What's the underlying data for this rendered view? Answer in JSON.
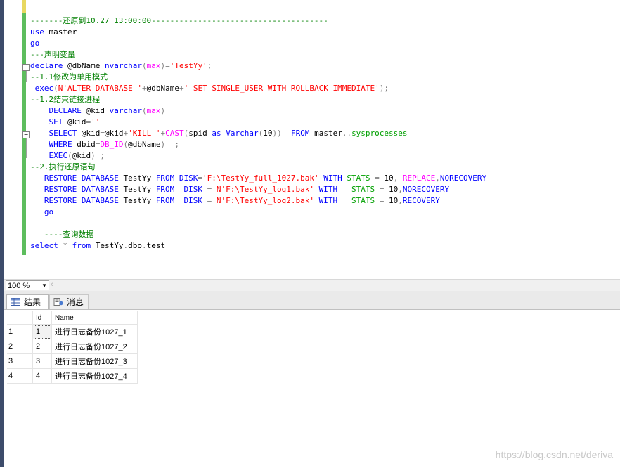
{
  "editor": {
    "lines": [
      [
        {
          "t": "-------还原到10.27 13:00:00--------------------------------------",
          "c": "c"
        }
      ],
      [
        {
          "t": "use",
          "c": "k"
        },
        {
          "t": " master",
          "c": "t"
        }
      ],
      [
        {
          "t": "go",
          "c": "k"
        }
      ],
      [
        {
          "t": "---声明变量",
          "c": "c"
        }
      ],
      [
        {
          "t": "declare",
          "c": "k"
        },
        {
          "t": " @dbName ",
          "c": "t"
        },
        {
          "t": "nvarchar",
          "c": "k"
        },
        {
          "t": "(",
          "c": "g"
        },
        {
          "t": "max",
          "c": "f"
        },
        {
          "t": ")=",
          "c": "g"
        },
        {
          "t": "'TestYy'",
          "c": "s"
        },
        {
          "t": ";",
          "c": "g"
        }
      ],
      [
        {
          "t": "--1.1修改为单用模式",
          "c": "c"
        }
      ],
      [
        {
          "t": " exec",
          "c": "k"
        },
        {
          "t": "(",
          "c": "g"
        },
        {
          "t": "N'ALTER DATABASE '",
          "c": "s"
        },
        {
          "t": "+",
          "c": "g"
        },
        {
          "t": "@dbName",
          "c": "t"
        },
        {
          "t": "+",
          "c": "g"
        },
        {
          "t": "' SET SINGLE_USER WITH ROLLBACK IMMEDIATE'",
          "c": "s"
        },
        {
          "t": ");",
          "c": "g"
        }
      ],
      [
        {
          "t": "--1.2结束链接进程",
          "c": "c"
        }
      ],
      [
        {
          "t": "    DECLARE",
          "c": "k"
        },
        {
          "t": " @kid ",
          "c": "t"
        },
        {
          "t": "varchar",
          "c": "k"
        },
        {
          "t": "(",
          "c": "g"
        },
        {
          "t": "max",
          "c": "f"
        },
        {
          "t": ")",
          "c": "g"
        }
      ],
      [
        {
          "t": "    SET",
          "c": "k"
        },
        {
          "t": " @kid",
          "c": "t"
        },
        {
          "t": "=",
          "c": "g"
        },
        {
          "t": "''",
          "c": "s"
        }
      ],
      [
        {
          "t": "    SELECT",
          "c": "k"
        },
        {
          "t": " @kid",
          "c": "t"
        },
        {
          "t": "=",
          "c": "g"
        },
        {
          "t": "@kid",
          "c": "t"
        },
        {
          "t": "+",
          "c": "g"
        },
        {
          "t": "'KILL '",
          "c": "s"
        },
        {
          "t": "+",
          "c": "g"
        },
        {
          "t": "CAST",
          "c": "f"
        },
        {
          "t": "(",
          "c": "g"
        },
        {
          "t": "spid ",
          "c": "t"
        },
        {
          "t": "as",
          "c": "k"
        },
        {
          "t": " Varchar",
          "c": "k"
        },
        {
          "t": "(",
          "c": "g"
        },
        {
          "t": "10",
          "c": "t"
        },
        {
          "t": "))  ",
          "c": "g"
        },
        {
          "t": "FROM",
          "c": "k"
        },
        {
          "t": " master",
          "c": "t"
        },
        {
          "t": "..",
          "c": "g"
        },
        {
          "t": "sysprocesses",
          "c": "sy"
        }
      ],
      [
        {
          "t": "    WHERE",
          "c": "k"
        },
        {
          "t": " dbid",
          "c": "t"
        },
        {
          "t": "=",
          "c": "g"
        },
        {
          "t": "DB_ID",
          "c": "f"
        },
        {
          "t": "(",
          "c": "g"
        },
        {
          "t": "@dbName",
          "c": "t"
        },
        {
          "t": ")  ;",
          "c": "g"
        }
      ],
      [
        {
          "t": "    EXEC",
          "c": "k"
        },
        {
          "t": "(",
          "c": "g"
        },
        {
          "t": "@kid",
          "c": "t"
        },
        {
          "t": ") ;",
          "c": "g"
        }
      ],
      [
        {
          "t": "--2.执行还原语句",
          "c": "c"
        }
      ],
      [
        {
          "t": "   RESTORE DATABASE ",
          "c": "k"
        },
        {
          "t": "TestYy ",
          "c": "t"
        },
        {
          "t": "FROM DISK",
          "c": "k"
        },
        {
          "t": "=",
          "c": "g"
        },
        {
          "t": "'F:\\TestYy_full_1027.bak'",
          "c": "s"
        },
        {
          "t": " WITH ",
          "c": "k"
        },
        {
          "t": "STATS",
          "c": "sy"
        },
        {
          "t": " = ",
          "c": "g"
        },
        {
          "t": "10",
          "c": "t"
        },
        {
          "t": ", ",
          "c": "g"
        },
        {
          "t": "REPLACE",
          "c": "f"
        },
        {
          "t": ",",
          "c": "g"
        },
        {
          "t": "NORECOVERY",
          "c": "k"
        }
      ],
      [
        {
          "t": "   RESTORE DATABASE ",
          "c": "k"
        },
        {
          "t": "TestYy ",
          "c": "t"
        },
        {
          "t": "FROM  DISK ",
          "c": "k"
        },
        {
          "t": "= ",
          "c": "g"
        },
        {
          "t": "N'F:\\TestYy_log1.bak'",
          "c": "s"
        },
        {
          "t": " WITH   ",
          "c": "k"
        },
        {
          "t": "STATS",
          "c": "sy"
        },
        {
          "t": " = ",
          "c": "g"
        },
        {
          "t": "10",
          "c": "t"
        },
        {
          "t": ",",
          "c": "g"
        },
        {
          "t": "NORECOVERY",
          "c": "k"
        }
      ],
      [
        {
          "t": "   RESTORE DATABASE ",
          "c": "k"
        },
        {
          "t": "TestYy ",
          "c": "t"
        },
        {
          "t": "FROM  DISK ",
          "c": "k"
        },
        {
          "t": "= ",
          "c": "g"
        },
        {
          "t": "N'F:\\TestYy_log2.bak'",
          "c": "s"
        },
        {
          "t": " WITH   ",
          "c": "k"
        },
        {
          "t": "STATS",
          "c": "sy"
        },
        {
          "t": " = ",
          "c": "g"
        },
        {
          "t": "10",
          "c": "t"
        },
        {
          "t": ",",
          "c": "g"
        },
        {
          "t": "RECOVERY",
          "c": "k"
        }
      ],
      [
        {
          "t": "   go",
          "c": "k"
        }
      ],
      [
        {
          "t": "",
          "c": "t"
        }
      ],
      [
        {
          "t": "   ----查询数据",
          "c": "c"
        }
      ],
      [
        {
          "t": "select",
          "c": "k"
        },
        {
          "t": " * ",
          "c": "g"
        },
        {
          "t": "from",
          "c": "k"
        },
        {
          "t": " TestYy",
          "c": "t"
        },
        {
          "t": ".",
          "c": "g"
        },
        {
          "t": "dbo",
          "c": "t"
        },
        {
          "t": ".",
          "c": "g"
        },
        {
          "t": "test",
          "c": "t"
        }
      ]
    ]
  },
  "status": {
    "zoom": "100 %"
  },
  "tabs": {
    "results": "结果",
    "messages": "消息"
  },
  "grid": {
    "headers": [
      "Id",
      "Name"
    ],
    "rows": [
      {
        "n": "1",
        "id": "1",
        "name": "进行日志备份1027_1"
      },
      {
        "n": "2",
        "id": "2",
        "name": "进行日志备份1027_2"
      },
      {
        "n": "3",
        "id": "3",
        "name": "进行日志备份1027_3"
      },
      {
        "n": "4",
        "id": "4",
        "name": "进行日志备份1027_4"
      }
    ]
  },
  "watermark": "https://blog.csdn.net/deriva"
}
